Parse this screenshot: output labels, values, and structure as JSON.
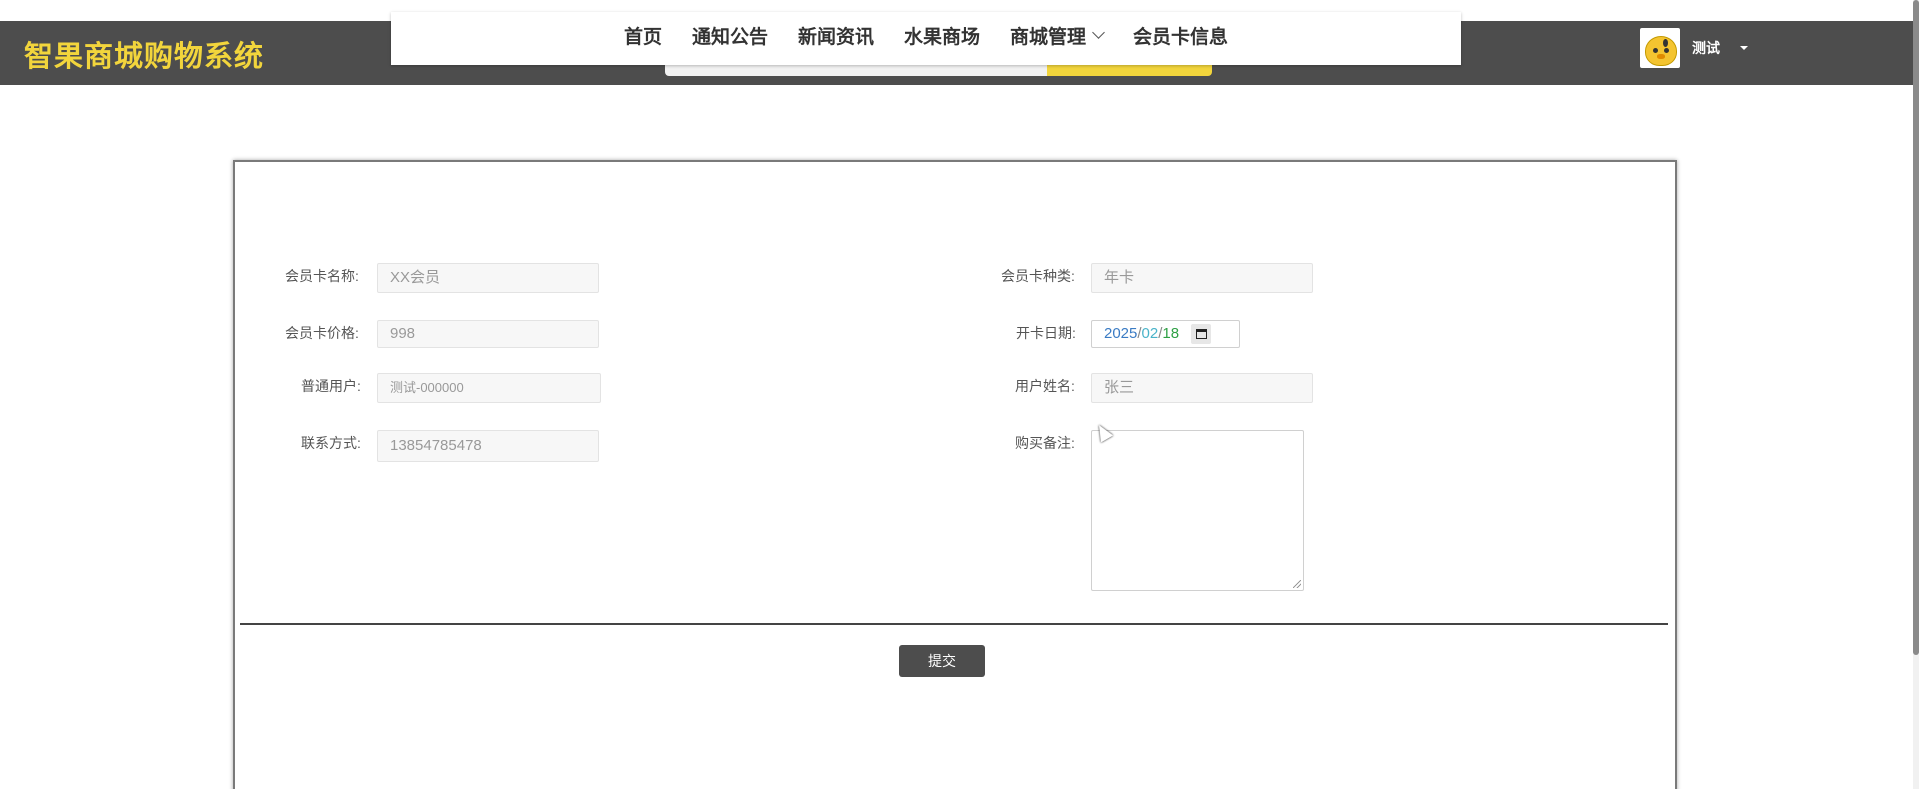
{
  "app": {
    "brand": "智果商城购物系统"
  },
  "nav": {
    "items": [
      {
        "label": "首页"
      },
      {
        "label": "通知公告"
      },
      {
        "label": "新闻资讯"
      },
      {
        "label": "水果商场"
      },
      {
        "label": "商城管理"
      },
      {
        "label": "会员卡信息"
      }
    ]
  },
  "user": {
    "name": "测试"
  },
  "form": {
    "card_name": {
      "label": "会员卡名称:",
      "placeholder": "XX会员"
    },
    "card_type": {
      "label": "会员卡种类:",
      "placeholder": "年卡"
    },
    "card_price": {
      "label": "会员卡价格:",
      "placeholder": "998"
    },
    "open_date": {
      "label": "开卡日期:",
      "year": "2025",
      "month": "02",
      "day": "18",
      "sep": "/"
    },
    "normal_user": {
      "label": "普通用户:",
      "value": "测试-000000"
    },
    "user_name": {
      "label": "用户姓名:",
      "placeholder": "张三"
    },
    "contact": {
      "label": "联系方式:",
      "placeholder": "13854785478"
    },
    "remark": {
      "label": "购买备注:",
      "value": ""
    },
    "submit_label": "提交"
  },
  "colors": {
    "header_bg": "#4d4d4d",
    "brand": "#f2d53c",
    "button_bg": "#4d4d4d"
  }
}
